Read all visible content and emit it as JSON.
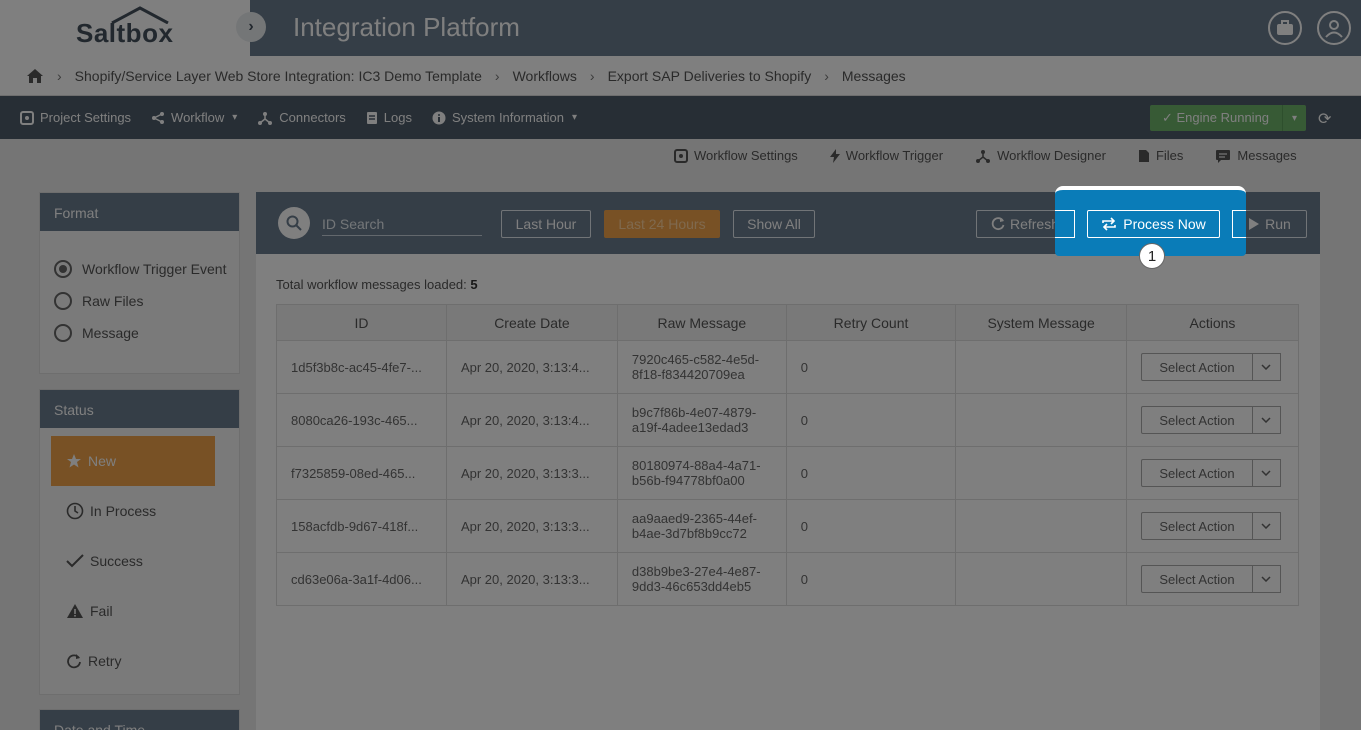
{
  "header": {
    "logo": "Saltbox",
    "title": "Integration Platform"
  },
  "breadcrumb": [
    "Shopify/Service Layer Web Store Integration: IC3 Demo Template",
    "Workflows",
    "Export SAP Deliveries to Shopify",
    "Messages"
  ],
  "nav": {
    "project_settings": "Project Settings",
    "workflow": "Workflow",
    "connectors": "Connectors",
    "logs": "Logs",
    "system_information": "System Information",
    "engine_status": "Engine Running"
  },
  "subtabs": {
    "workflow_settings": "Workflow Settings",
    "workflow_trigger": "Workflow Trigger",
    "workflow_designer": "Workflow Designer",
    "files": "Files",
    "messages": "Messages"
  },
  "sidebar": {
    "format_title": "Format",
    "format_options": [
      "Workflow Trigger Event",
      "Raw Files",
      "Message"
    ],
    "status_title": "Status",
    "status_items": [
      "New",
      "In Process",
      "Success",
      "Fail",
      "Retry"
    ],
    "date_title": "Date and Time"
  },
  "toolbar": {
    "search_placeholder": "ID Search",
    "last_hour": "Last Hour",
    "last_24": "Last 24 Hours",
    "show_all": "Show All",
    "refresh": "Refresh",
    "process_now": "Process Now",
    "run": "Run"
  },
  "total_label": "Total workflow messages loaded:",
  "total_count": "5",
  "table": {
    "headers": [
      "ID",
      "Create Date",
      "Raw Message",
      "Retry Count",
      "System Message",
      "Actions"
    ],
    "action_label": "Select Action",
    "rows": [
      {
        "id": "1d5f3b8c-ac45-4fe7-...",
        "date": "Apr 20, 2020, 3:13:4...",
        "raw1": "7920c465-c582-4e5d-",
        "raw2": "8f18-f834420709ea",
        "retry": "0",
        "sys": ""
      },
      {
        "id": "8080ca26-193c-465...",
        "date": "Apr 20, 2020, 3:13:4...",
        "raw1": "b9c7f86b-4e07-4879-",
        "raw2": "a19f-4adee13edad3",
        "retry": "0",
        "sys": ""
      },
      {
        "id": "f7325859-08ed-465...",
        "date": "Apr 20, 2020, 3:13:3...",
        "raw1": "80180974-88a4-4a71-",
        "raw2": "b56b-f94778bf0a00",
        "retry": "0",
        "sys": ""
      },
      {
        "id": "158acfdb-9d67-418f...",
        "date": "Apr 20, 2020, 3:13:3...",
        "raw1": "aa9aaed9-2365-44ef-",
        "raw2": "b4ae-3d7bf8b9cc72",
        "retry": "0",
        "sys": ""
      },
      {
        "id": "cd63e06a-3a1f-4d06...",
        "date": "Apr 20, 2020, 3:13:3...",
        "raw1": "d38b9be3-27e4-4e87-",
        "raw2": "9dd3-46c653dd4eb5",
        "retry": "0",
        "sys": ""
      }
    ]
  },
  "callout": {
    "number": "1"
  },
  "colors": {
    "header": "#6b7c8e",
    "navbar": "#4f5d6b",
    "accent_orange": "#f0a34b",
    "engine_green": "#6fb56b",
    "highlight_blue": "#0a7cb8"
  }
}
